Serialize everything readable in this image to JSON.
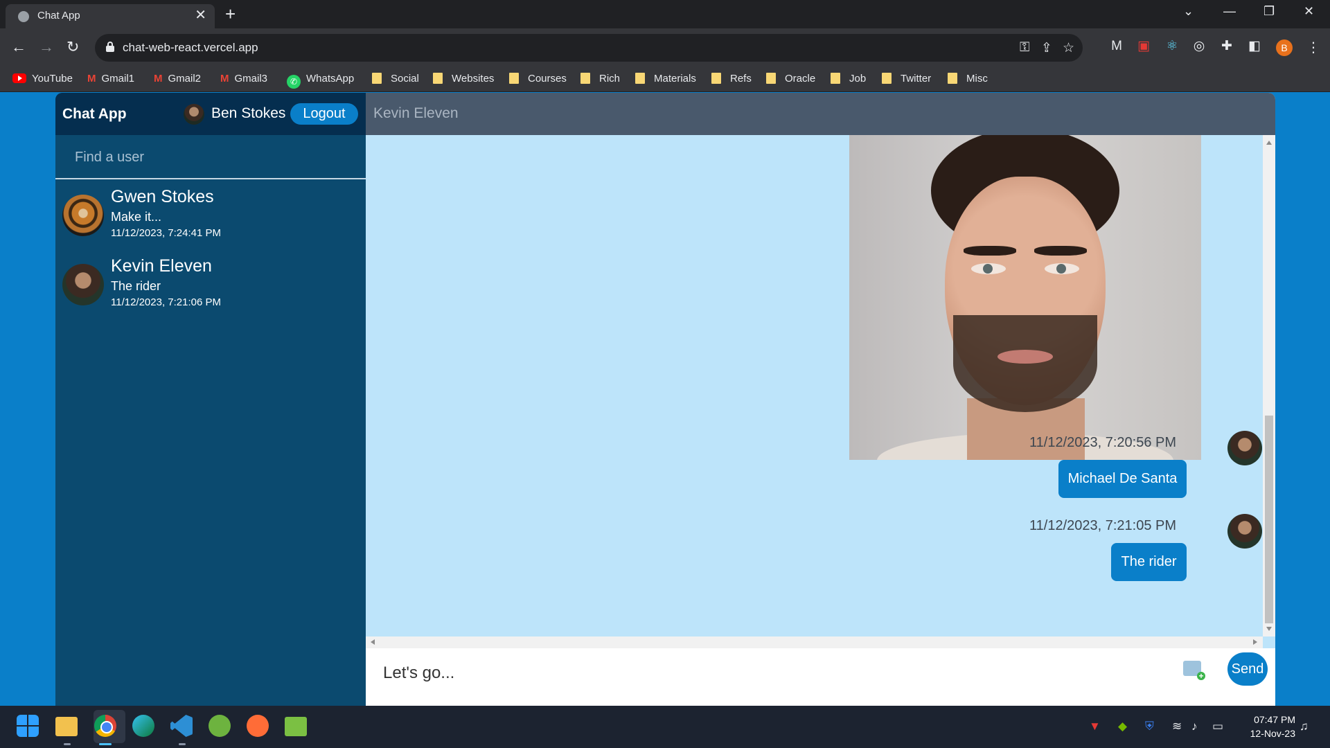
{
  "browser": {
    "tab_title": "Chat App",
    "tab_close": "✕",
    "new_tab": "+",
    "url": "chat-web-react.vercel.app",
    "profile_initial": "B",
    "bookmarks": [
      "YouTube",
      "Gmail1",
      "Gmail2",
      "Gmail3",
      "WhatsApp",
      "Social",
      "Websites",
      "Courses",
      "Rich",
      "Materials",
      "Refs",
      "Oracle",
      "Job",
      "Twitter",
      "Misc"
    ]
  },
  "app": {
    "title": "Chat App",
    "current_user": "Ben Stokes",
    "logout_label": "Logout",
    "search_placeholder": "Find a user",
    "users": [
      {
        "name": "Gwen Stokes",
        "last_message": "Make it...",
        "timestamp": "11/12/2023, 7:24:41 PM"
      },
      {
        "name": "Kevin Eleven",
        "last_message": "The rider",
        "timestamp": "11/12/2023, 7:21:06 PM"
      }
    ],
    "chat_peer": "Kevin Eleven",
    "messages": [
      {
        "timestamp": "11/12/2023, 7:20:56 PM",
        "text": "Michael De Santa"
      },
      {
        "timestamp": "11/12/2023, 7:21:05 PM",
        "text": "The rider"
      }
    ],
    "composer_value": "Let's go...",
    "send_label": "Send"
  },
  "taskbar": {
    "time": "07:47 PM",
    "date": "12-Nov-23"
  },
  "colors": {
    "page_bg": "#0a7fc9",
    "sidebar_bg": "#0b4a6f",
    "sidebar_header_bg": "#052e4f",
    "chat_header_bg": "#49596c",
    "chat_bg": "#bde4fa",
    "accent": "#0a7fc9"
  }
}
